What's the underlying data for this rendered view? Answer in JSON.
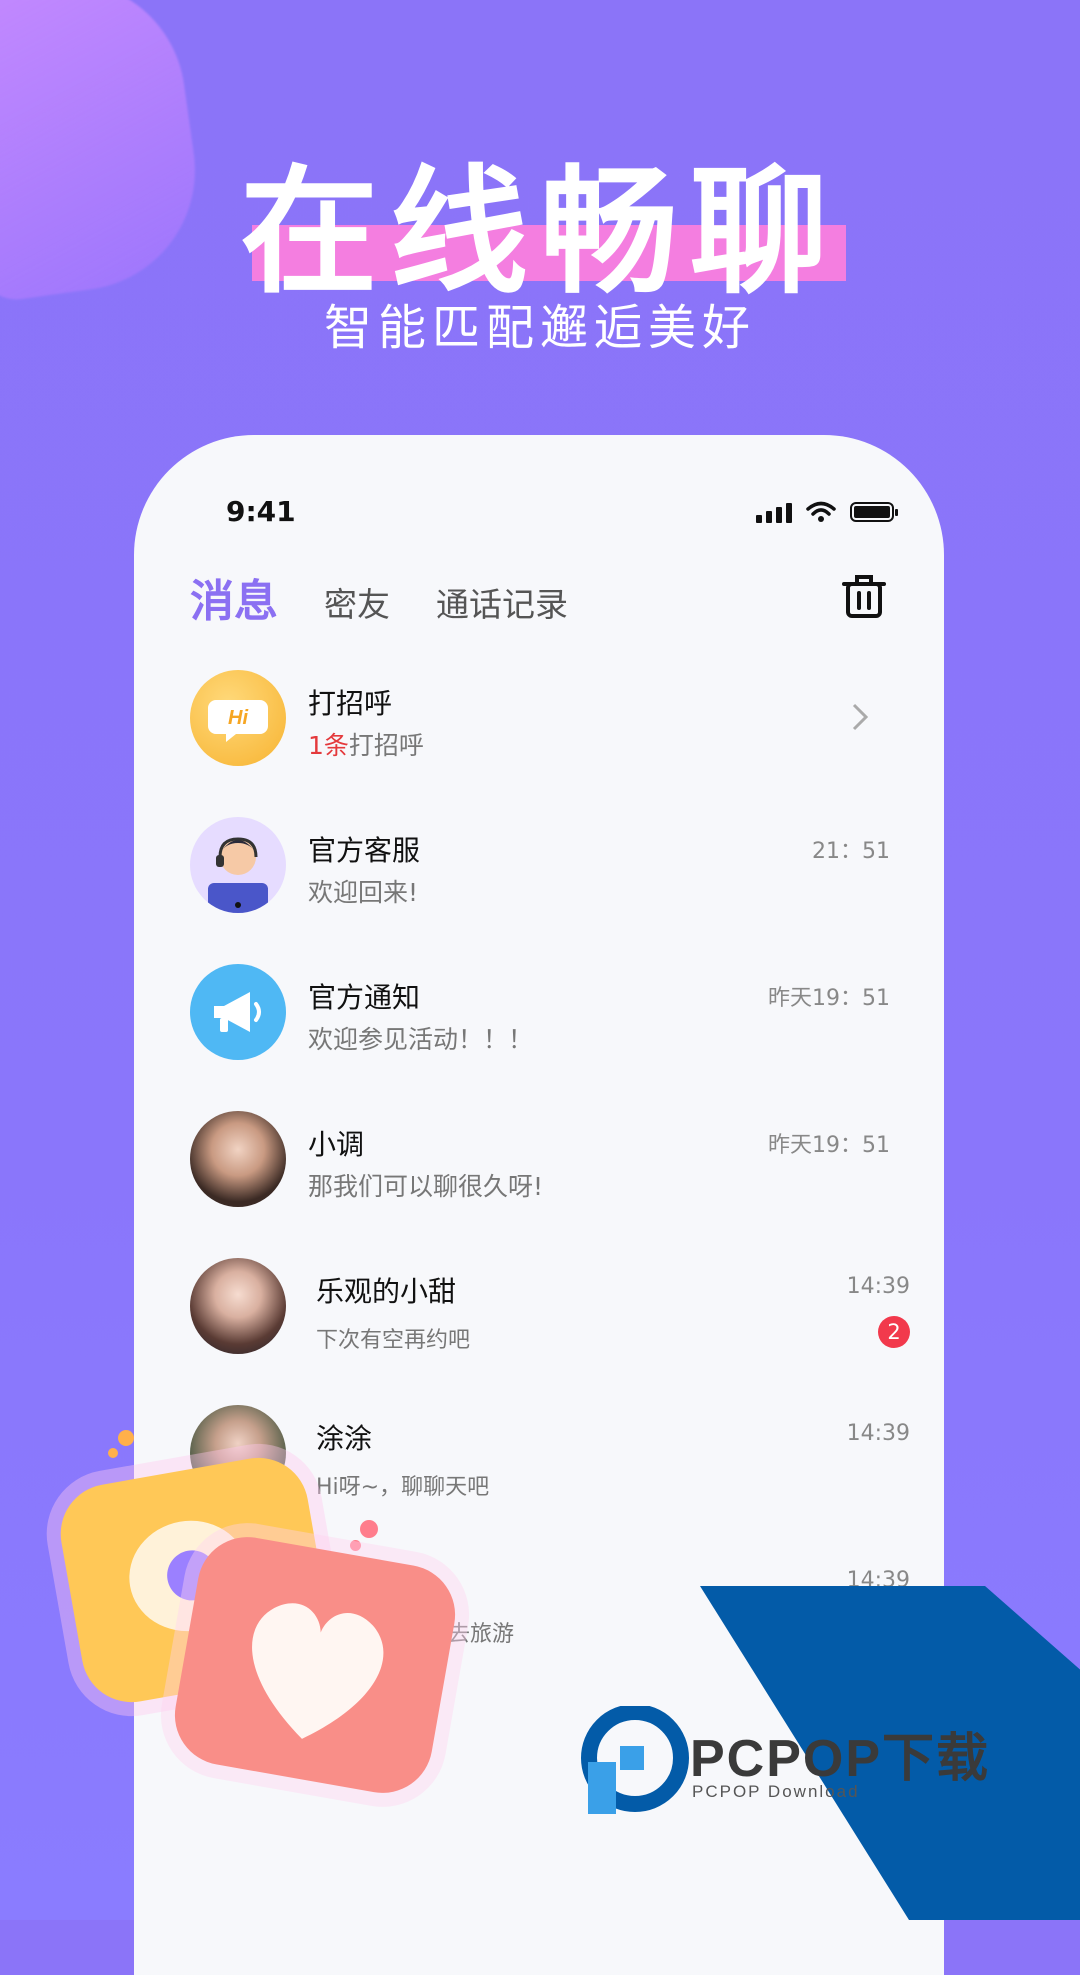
{
  "banner": {
    "headline": "在线畅聊",
    "subline": "智能匹配邂逅美好"
  },
  "status_bar": {
    "time": "9:41"
  },
  "tabs": [
    {
      "label": "消息",
      "active": true
    },
    {
      "label": "密友",
      "active": false
    },
    {
      "label": "通话记录",
      "active": false
    }
  ],
  "conversations": [
    {
      "name": "打招呼",
      "count": "1条",
      "message": "打招呼",
      "time": ""
    },
    {
      "name": "官方客服",
      "message": "欢迎回来!",
      "time": "21：51"
    },
    {
      "name": "官方通知",
      "message": "欢迎参见活动！！！",
      "time": "昨天19：51"
    },
    {
      "name": "小调",
      "message": "那我们可以聊很久呀!",
      "time": "昨天19：51"
    },
    {
      "name": "乐观的小甜",
      "message": "下次有空再约吧",
      "time": "14:39",
      "unread": "2"
    },
    {
      "name": "涂涂",
      "message": "Hi呀~，聊聊天吧",
      "time": "14:39"
    },
    {
      "name": "",
      "message": "去旅游",
      "time": "14:39"
    }
  ],
  "avatar_text": {
    "hi": "Hi"
  },
  "watermark": {
    "title": "PCPOP下载",
    "subtitle": "PCPOP Download"
  },
  "colors": {
    "background": "#8b74f8",
    "accent": "#8b70f2",
    "badge": "#f2394c",
    "highlight": "#f47ee0",
    "watermark_blue": "#035ba8"
  }
}
